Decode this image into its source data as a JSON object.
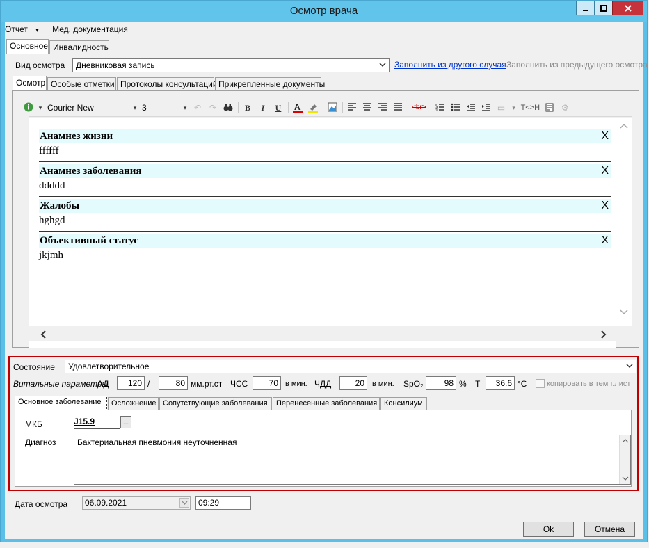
{
  "window": {
    "title": "Осмотр врача"
  },
  "menu": {
    "report": "Отчет",
    "report_arrow": "▾",
    "med_docs": "Мед. документация"
  },
  "top_tabs": [
    {
      "label": "Основное"
    },
    {
      "label": "Инвалидность"
    }
  ],
  "exam_type": {
    "label": "Вид осмотра",
    "value": "Дневниковая запись",
    "fill_other_link": "Заполнить из другого случая",
    "fill_prev_link": "Заполнить из предыдущего осмотра"
  },
  "sub_tabs": [
    {
      "label": "Осмотр"
    },
    {
      "label": "Особые отметки"
    },
    {
      "label": "Протоколы консультаций"
    },
    {
      "label": "Прикрепленные документы"
    }
  ],
  "editor_toolbar": {
    "font_name": "Courier New",
    "font_size": "3",
    "bold": "B",
    "italic": "I",
    "underline": "U",
    "br_tag": "<br>",
    "t_h": "T<>H"
  },
  "sections": [
    {
      "title": "Анамнез жизни",
      "body": "ffffff",
      "close": "X"
    },
    {
      "title": "Анамнез заболевания",
      "body": "ddddd",
      "close": "X"
    },
    {
      "title": "Жалобы",
      "body": "hghgd",
      "close": "X"
    },
    {
      "title": "Объективный статус",
      "body": "jkjmh",
      "close": "X"
    }
  ],
  "state": {
    "label": "Состояние",
    "value": "Удовлетворительное"
  },
  "vitals": {
    "label": "Витальные параметры",
    "ad_label": "АД",
    "ad_sys": "120",
    "ad_sep": "/",
    "ad_dia": "80",
    "ad_unit": "мм.рт.ст",
    "hr_label": "ЧСС",
    "hr": "70",
    "hr_unit": "в мин.",
    "rr_label": "ЧДД",
    "rr": "20",
    "rr_unit": "в мин.",
    "spo2_label": "SpO₂",
    "spo2": "98",
    "spo2_unit": "%",
    "t_label": "T",
    "t": "36.6",
    "t_unit": "°С",
    "copy_label": "копировать в темп.лист"
  },
  "diag_tabs": [
    {
      "label": "Основное заболевание"
    },
    {
      "label": "Осложнение"
    },
    {
      "label": "Сопутствующие заболевания"
    },
    {
      "label": "Перенесенные заболевания"
    },
    {
      "label": "Консилиум"
    }
  ],
  "diagnosis": {
    "mkb_label": "МКБ",
    "mkb_value": "J15.9",
    "mkb_btn": "...",
    "diag_label": "Диагноз",
    "diag_value": "Бактериальная пневмония неуточненная"
  },
  "exam_date": {
    "label": "Дата осмотра",
    "date": "06.09.2021",
    "time": "09:29"
  },
  "buttons": {
    "ok": "Ok",
    "cancel": "Отмена"
  },
  "colors": {
    "title_bar": "#60c4eb",
    "section_bg": "#e4fbfd",
    "highlight_border": "#c00000",
    "close_btn": "#c7333a"
  }
}
